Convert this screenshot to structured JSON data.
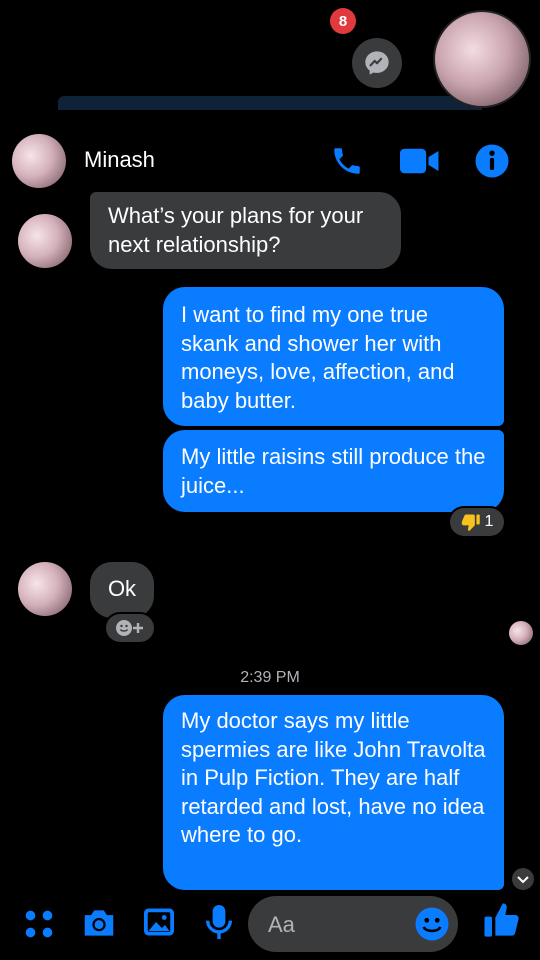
{
  "chathead": {
    "badge_count": "8"
  },
  "header": {
    "contact_name": "Minash"
  },
  "messages": [
    {
      "direction": "incoming",
      "text": "What’s your plans for your next relationship?"
    },
    {
      "direction": "outgoing",
      "text": "I want to find my one true skank and shower her with moneys, love, affection, and baby butter."
    },
    {
      "direction": "outgoing",
      "text": "My little raisins still produce the juice...",
      "reaction": {
        "icon": "thumbs-down-emoji",
        "count": "1"
      }
    },
    {
      "direction": "incoming",
      "text": "Ok"
    },
    {
      "direction": "outgoing",
      "text": "My doctor says my little spermies are like John Travolta in Pulp Fiction. They are half retarded and lost, have no idea where to go."
    }
  ],
  "timestamp": "2:39 PM",
  "composer": {
    "placeholder": "Aa"
  },
  "colors": {
    "outgoing_bubble": "#0a7cff",
    "incoming_bubble": "#3a3b3c",
    "accent_blue": "#0a7cff",
    "badge_red": "#e0393e"
  }
}
